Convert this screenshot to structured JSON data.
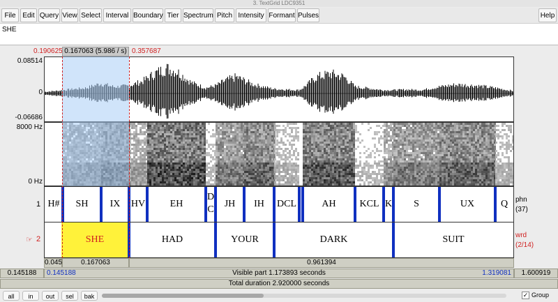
{
  "window": {
    "title": "3. TextGrid LDC9351"
  },
  "menu": [
    "File",
    "Edit",
    "Query",
    "View",
    "Select",
    "Interval",
    "Boundary",
    "Tier",
    "Spectrum",
    "Pitch",
    "Intensity",
    "Formant",
    "Pulses"
  ],
  "help": "Help",
  "text_field": {
    "value": "SHE"
  },
  "top": {
    "sel_start": "0.190625",
    "sel_len": "0.167063 (5.986 / s)",
    "sel_end": "0.357687"
  },
  "wave": {
    "ymax": "0.08514",
    "yzero": "0",
    "ymin": "-0.06686"
  },
  "spec": {
    "ymax": "8000 Hz",
    "ymin": "0 Hz"
  },
  "tier1": {
    "number": "1",
    "name": "phn",
    "count": "(37)",
    "labels": [
      "H#",
      "SH",
      "IX",
      "HV",
      "EH",
      "D",
      "C",
      "JH",
      "IH",
      "DCL",
      "AH",
      "KCL",
      "K",
      "S",
      "UX",
      "Q"
    ]
  },
  "tier2": {
    "number": "2",
    "pointer": "☞",
    "name": "wrd",
    "count": "(2/14)",
    "labels": [
      "SHE",
      "HAD",
      "YOUR",
      "DARK",
      "SUIT"
    ]
  },
  "bottom_bars": {
    "row1": [
      "0.045",
      "0.167063",
      "0.961394"
    ],
    "row2": {
      "left": "0.145188",
      "start": "0.145188",
      "visible": "Visible part 1.173893 seconds",
      "end": "1.319081",
      "right": "1.600919"
    },
    "row3": "Total duration 2.920000 seconds"
  },
  "buttons": [
    "all",
    "in",
    "out",
    "sel",
    "bak"
  ],
  "group": {
    "label": "Group",
    "checked": "✓"
  },
  "colors": {
    "selection": "#aacdf5",
    "boundary": "#1030c0",
    "selected_interval": "#fff23a",
    "red_text": "#d02020",
    "blue_text": "#1030c0"
  }
}
